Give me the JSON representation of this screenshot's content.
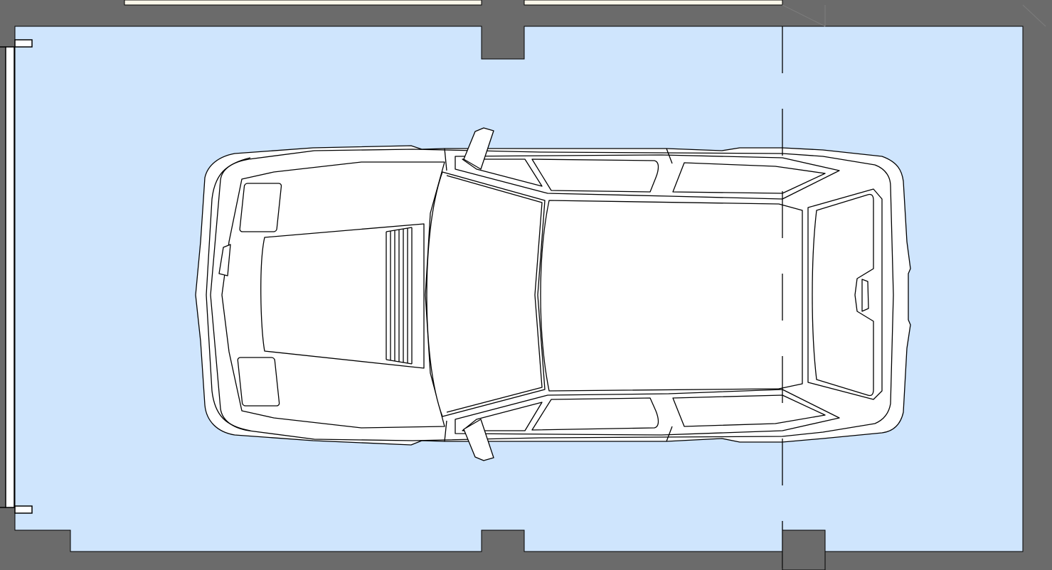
{
  "plan": {
    "colors": {
      "wall": "#6b6b6b",
      "floor": "#cfe5fd",
      "adjacent_room": "#fbf7ea",
      "line": "#000000",
      "car_body": "#ffffff"
    },
    "elements": [
      "garage-door",
      "car-top-view",
      "axis-line",
      "wall-columns"
    ]
  }
}
